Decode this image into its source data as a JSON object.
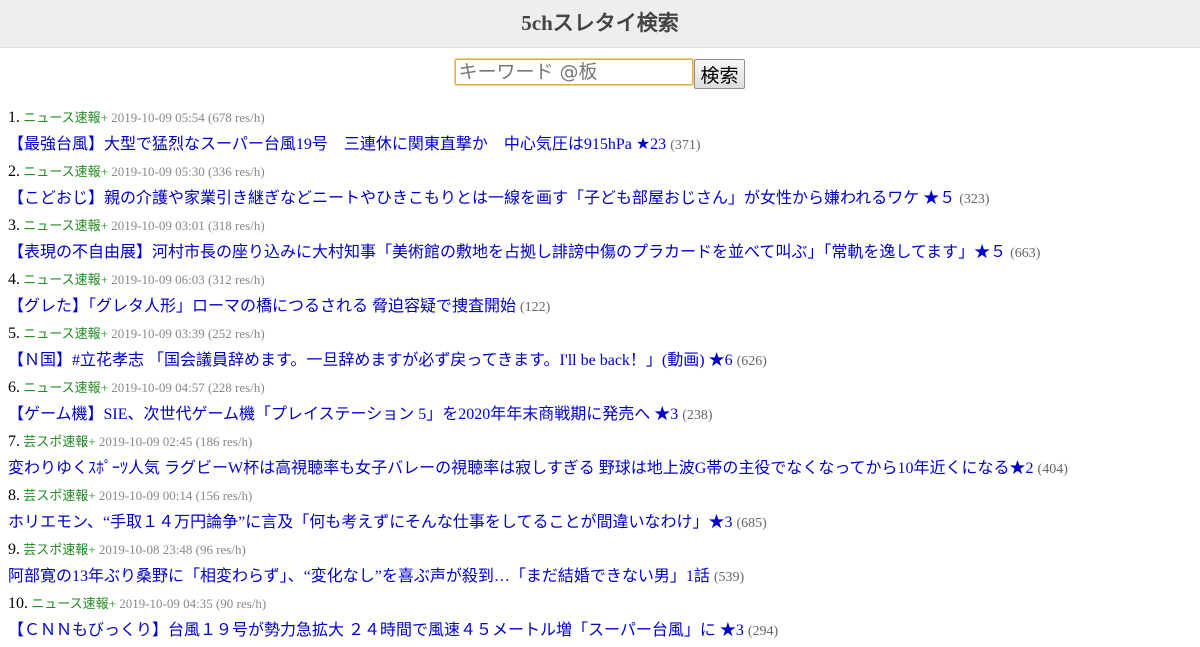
{
  "header": {
    "title": "5chスレタイ検索"
  },
  "search": {
    "placeholder": "キーワード @板",
    "button_label": "検索"
  },
  "results": [
    {
      "num": "1.",
      "board": "ニュース速報+",
      "date": "2019-10-09 05:54",
      "rate": "(678 res/h)",
      "title": "【最強台風】大型で猛烈なスーパー台風19号　三連休に関東直撃か　中心気圧は915hPa ★23",
      "count": "(371)"
    },
    {
      "num": "2.",
      "board": "ニュース速報+",
      "date": "2019-10-09 05:30",
      "rate": "(336 res/h)",
      "title": "【こどおじ】親の介護や家業引き継ぎなどニートやひきこもりとは一線を画す「子ども部屋おじさん」が女性から嫌われるワケ ★５",
      "count": "(323)"
    },
    {
      "num": "3.",
      "board": "ニュース速報+",
      "date": "2019-10-09 03:01",
      "rate": "(318 res/h)",
      "title": "【表現の不自由展】河村市長の座り込みに大村知事「美術館の敷地を占拠し誹謗中傷のプラカードを並べて叫ぶ」「常軌を逸してます」★５",
      "count": "(663)"
    },
    {
      "num": "4.",
      "board": "ニュース速報+",
      "date": "2019-10-09 06:03",
      "rate": "(312 res/h)",
      "title": "【グレた】「グレタ人形」ローマの橋につるされる 脅迫容疑で捜査開始",
      "count": "(122)"
    },
    {
      "num": "5.",
      "board": "ニュース速報+",
      "date": "2019-10-09 03:39",
      "rate": "(252 res/h)",
      "title": "【Ｎ国】#立花孝志 「国会議員辞めます。一旦辞めますが必ず戻ってきます。I'll be back！」(動画) ★6",
      "count": "(626)"
    },
    {
      "num": "6.",
      "board": "ニュース速報+",
      "date": "2019-10-09 04:57",
      "rate": "(228 res/h)",
      "title": "【ゲーム機】SIE、次世代ゲーム機「プレイステーション 5」を2020年年末商戦期に発売へ ★3",
      "count": "(238)"
    },
    {
      "num": "7.",
      "board": "芸スポ速報+",
      "date": "2019-10-09 02:45",
      "rate": "(186 res/h)",
      "title": "変わりゆくｽﾎﾟｰﾂ人気 ラグビーW杯は高視聴率も女子バレーの視聴率は寂しすぎる 野球は地上波G帯の主役でなくなってから10年近くになる★2",
      "count": "(404)"
    },
    {
      "num": "8.",
      "board": "芸スポ速報+",
      "date": "2019-10-09 00:14",
      "rate": "(156 res/h)",
      "title": "ホリエモン、“手取１４万円論争”に言及「何も考えずにそんな仕事をしてることが間違いなわけ」★3",
      "count": "(685)"
    },
    {
      "num": "9.",
      "board": "芸スポ速報+",
      "date": "2019-10-08 23:48",
      "rate": "(96 res/h)",
      "title": "阿部寛の13年ぶり桑野に「相変わらず」、“変化なし”を喜ぶ声が殺到…「まだ結婚できない男」1話",
      "count": "(539)"
    },
    {
      "num": "10.",
      "board": "ニュース速報+",
      "date": "2019-10-09 04:35",
      "rate": "(90 res/h)",
      "title": "【ＣＮＮもびっくり】台風１９号が勢力急拡大 ２４時間で風速４５メートル増「スーパー台風」に ★3",
      "count": "(294)"
    }
  ]
}
